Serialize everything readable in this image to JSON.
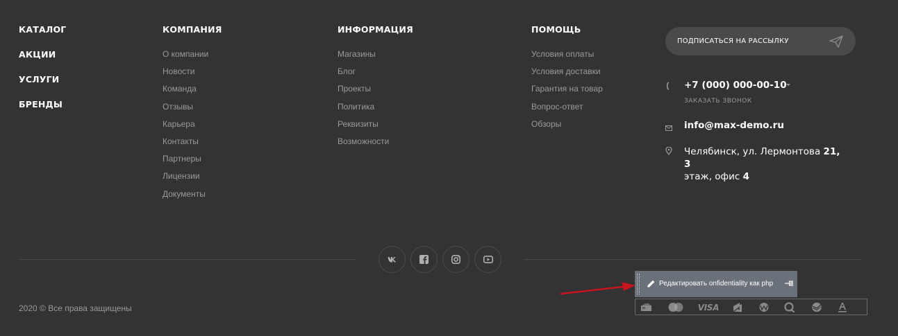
{
  "catalog_nav": [
    "КАТАЛОГ",
    "АКЦИИ",
    "УСЛУГИ",
    "БРЕНДЫ"
  ],
  "company": {
    "title": "КОМПАНИЯ",
    "items": [
      "О компании",
      "Новости",
      "Команда",
      "Отзывы",
      "Карьера",
      "Контакты",
      "Партнеры",
      "Лицензии",
      "Документы"
    ]
  },
  "info": {
    "title": "ИНФОРМАЦИЯ",
    "items": [
      "Магазины",
      "Блог",
      "Проекты",
      "Политика",
      "Реквизиты",
      "Возможности"
    ]
  },
  "help": {
    "title": "ПОМОЩЬ",
    "items": [
      "Условия оплаты",
      "Условия доставки",
      "Гарантия на товар",
      "Вопрос-ответ",
      "Обзоры"
    ]
  },
  "subscribe": {
    "label": "ПОДПИСАТЬСЯ НА РАССЫЛКУ",
    "icon": "paper-plane-icon"
  },
  "contacts": {
    "phone": "+7 (000) 000-00-10",
    "callback": "ЗАКАЗАТЬ ЗВОНОК",
    "email": "info@max-demo.ru",
    "address_line1_normal": "Челябинск, ул. Лермонтова ",
    "address_line1_bold": "21, 3",
    "address_line2_normal": "этаж, офис ",
    "address_line2_bold": "4"
  },
  "social": [
    {
      "name": "vk-icon"
    },
    {
      "name": "facebook-icon"
    },
    {
      "name": "instagram-icon"
    },
    {
      "name": "youtube-icon"
    }
  ],
  "copyright": "2020 © Все права защищены",
  "edit_panel": {
    "label": "Редактировать onfidentiality как php"
  },
  "payments": {
    "visa_label": "VISA",
    "icons": [
      "cash-icon",
      "mastercard-icon",
      "visa-icon",
      "yandex-money-icon",
      "webmoney-icon",
      "qiwi-icon",
      "sberbank-icon",
      "alfabank-icon"
    ]
  },
  "colors": {
    "background": "#333333",
    "subscribe_bg": "#4a4a4a",
    "edit_panel_bg": "#6b717a",
    "arrow": "#c8141c"
  }
}
